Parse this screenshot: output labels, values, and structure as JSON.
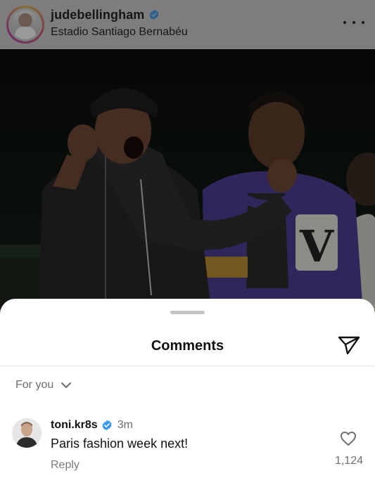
{
  "post": {
    "username": "judebellingham",
    "location": "Estadio Santiago Bernabéu",
    "avatar_icon": "profile-photo",
    "verified_icon": "verified-badge-icon",
    "more_icon": "more-options-icon",
    "colors": {
      "verified": "#3897f0",
      "sheet_bg": "#ffffff",
      "dim_header": "#7d7d7d"
    }
  },
  "photo": {
    "description_icon": "post-photo",
    "jacket_letter": "V"
  },
  "comments_sheet": {
    "title": "Comments",
    "share_icon": "send-icon",
    "sort_label": "For you",
    "sort_icon": "chevron-down-icon"
  },
  "comments": [
    {
      "username": "toni.kr8s",
      "time": "3m",
      "text": "Paris fashion week next!",
      "reply_label": "Reply",
      "like_count": "1,124",
      "like_icon": "heart-icon"
    }
  ]
}
